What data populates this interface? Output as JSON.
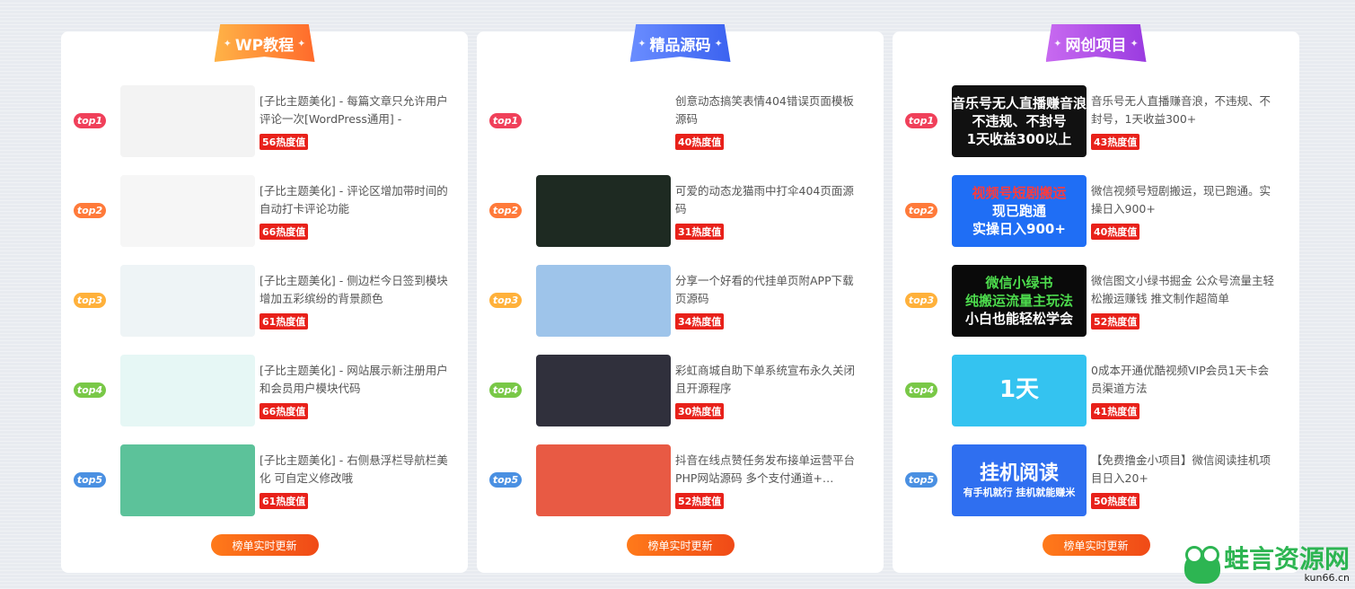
{
  "hot_suffix": "热度值",
  "update_label": "榜单实时更新",
  "watermark": {
    "name": "蛙言资源网",
    "domain": "kun66.cn"
  },
  "rank_labels": [
    "top1",
    "top2",
    "top3",
    "top4",
    "top5"
  ],
  "rank_colors": [
    "#f0405a",
    "#ff7a3a",
    "#ffb13b",
    "#79c847",
    "#4a90e2"
  ],
  "panels": [
    {
      "title": "WP教程",
      "ribbon_gradient": [
        "#ffb347",
        "#ff6a2b"
      ],
      "items": [
        {
          "title": "[子比主题美化] - 每篇文章只允许用户评论一次[WordPress通用] -",
          "hot": "56",
          "thumb_text": "",
          "thumb_bg": "#f3f3f3"
        },
        {
          "title": "[子比主题美化] - 评论区增加带时间的自动打卡评论功能",
          "hot": "66",
          "thumb_text": "",
          "thumb_bg": "#f6f6f6"
        },
        {
          "title": "[子比主题美化] - 侧边栏今日签到模块增加五彩缤纷的背景颜色",
          "hot": "61",
          "thumb_text": "",
          "thumb_bg": "#eef4f6"
        },
        {
          "title": "[子比主题美化] - 网站展示新注册用户和会员用户模块代码",
          "hot": "66",
          "thumb_text": "",
          "thumb_bg": "#e6f7f5"
        },
        {
          "title": "[子比主题美化] - 右侧悬浮栏导航栏美化 可自定义修改哦",
          "hot": "61",
          "thumb_text": "",
          "thumb_bg": "#5cc29a"
        }
      ]
    },
    {
      "title": "精品源码",
      "ribbon_gradient": [
        "#6a8dff",
        "#3b62f0"
      ],
      "items": [
        {
          "title": "创意动态搞笑表情404错误页面模板源码",
          "hot": "40",
          "thumb_text": "",
          "thumb_bg": "#ffffff"
        },
        {
          "title": "可爱的动态龙猫雨中打伞404页面源码",
          "hot": "31",
          "thumb_text": "",
          "thumb_bg": "#1e2a22"
        },
        {
          "title": "分享一个好看的代挂单页附APP下载页源码",
          "hot": "34",
          "thumb_text": "",
          "thumb_bg": "#9ec4ea"
        },
        {
          "title": "彩虹商城自助下单系统宣布永久关闭且开源程序",
          "hot": "30",
          "thumb_text": "",
          "thumb_bg": "#30303c"
        },
        {
          "title": "抖音在线点赞任务发布接单运营平台PHP网站源码 多个支付通道+…",
          "hot": "52",
          "thumb_text": "",
          "thumb_bg": "#e85a44"
        }
      ]
    },
    {
      "title": "网创项目",
      "ribbon_gradient": [
        "#c86af0",
        "#9a3be0"
      ],
      "items": [
        {
          "title": "音乐号无人直播赚音浪，不违规、不封号，1天收益300+",
          "hot": "43",
          "thumb_text": "音乐号无人直播赚音浪\n不违规、不封号\n1天收益300以上",
          "thumb_bg": "#111111"
        },
        {
          "title": "微信视频号短剧搬运，现已跑通。实操日入900+",
          "hot": "40",
          "thumb_text": "视频号短剧搬运\n现已跑通\n实操日入900+",
          "thumb_bg": "#1f6ef5"
        },
        {
          "title": "微信图文小绿书掘金 公众号流量主轻松搬运赚钱 推文制作超简单",
          "hot": "52",
          "thumb_text": "微信小绿书\n纯搬运流量主玩法\n小白也能轻松学会",
          "thumb_bg": "#0a0a0a"
        },
        {
          "title": "0成本开通优酷视频VIP会员1天卡会员渠道方法",
          "hot": "41",
          "thumb_text": "1天",
          "thumb_bg": "#34c3f0"
        },
        {
          "title": "【免费撸金小项目】微信阅读挂机项目日入20+",
          "hot": "50",
          "thumb_text": "挂机阅读\n有手机就行 挂机就能赚米",
          "thumb_bg": "#2f6ff0"
        }
      ]
    }
  ]
}
